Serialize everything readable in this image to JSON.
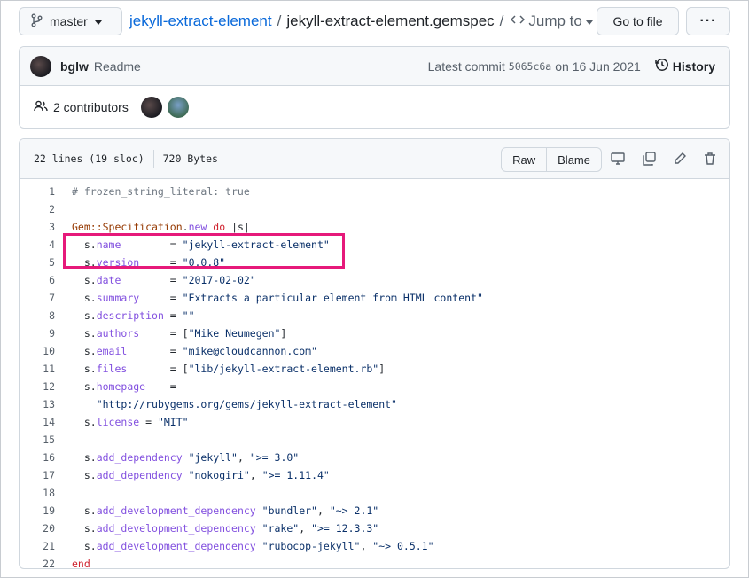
{
  "topbar": {
    "branch": "master",
    "repo": "jekyll-extract-element",
    "separator": "/",
    "file": "jekyll-extract-element.gemspec",
    "jump_to": "Jump to",
    "goto_file": "Go to file",
    "more": "···"
  },
  "commit": {
    "author": "bglw",
    "message": "Readme",
    "latest_label": "Latest commit",
    "sha": "5065c6a",
    "on": "on 16 Jun 2021",
    "history": "History",
    "contributors": "2 contributors"
  },
  "file": {
    "lines_info": "22 lines (19 sloc)",
    "size": "720 Bytes",
    "raw": "Raw",
    "blame": "Blame"
  },
  "code": [
    {
      "n": "1",
      "t": "# frozen_string_literal: true"
    },
    {
      "n": "2",
      "t": ""
    },
    {
      "n": "3",
      "t": "Gem::Specification.new do |s|"
    },
    {
      "n": "4",
      "t": "  s.name        = \"jekyll-extract-element\""
    },
    {
      "n": "5",
      "t": "  s.version     = \"0.0.8\""
    },
    {
      "n": "6",
      "t": "  s.date        = \"2017-02-02\""
    },
    {
      "n": "7",
      "t": "  s.summary     = \"Extracts a particular element from HTML content\""
    },
    {
      "n": "8",
      "t": "  s.description = \"\""
    },
    {
      "n": "9",
      "t": "  s.authors     = [\"Mike Neumegen\"]"
    },
    {
      "n": "10",
      "t": "  s.email       = \"mike@cloudcannon.com\""
    },
    {
      "n": "11",
      "t": "  s.files       = [\"lib/jekyll-extract-element.rb\"]"
    },
    {
      "n": "12",
      "t": "  s.homepage    ="
    },
    {
      "n": "13",
      "t": "    \"http://rubygems.org/gems/jekyll-extract-element\""
    },
    {
      "n": "14",
      "t": "  s.license = \"MIT\""
    },
    {
      "n": "15",
      "t": ""
    },
    {
      "n": "16",
      "t": "  s.add_dependency \"jekyll\", \">= 3.0\""
    },
    {
      "n": "17",
      "t": "  s.add_dependency \"nokogiri\", \">= 1.11.4\""
    },
    {
      "n": "18",
      "t": ""
    },
    {
      "n": "19",
      "t": "  s.add_development_dependency \"bundler\", \"~> 2.1\""
    },
    {
      "n": "20",
      "t": "  s.add_development_dependency \"rake\", \">= 12.3.3\""
    },
    {
      "n": "21",
      "t": "  s.add_development_dependency \"rubocop-jekyll\", \"~> 0.5.1\""
    },
    {
      "n": "22",
      "t": "end"
    }
  ],
  "colors": {
    "link": "#0969da",
    "highlight": "#e6197a",
    "string": "#0a3069",
    "comment": "#6e7781",
    "keyword": "#cf222e"
  }
}
